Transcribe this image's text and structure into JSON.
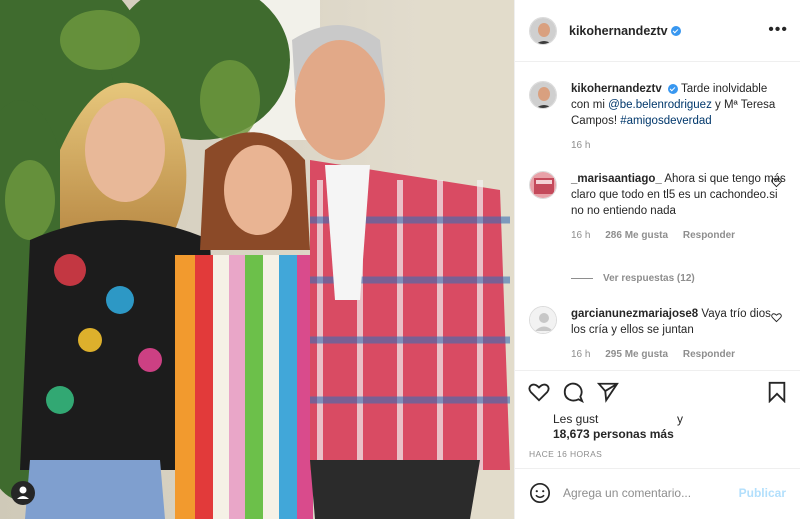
{
  "post": {
    "username": "kikohernandeztv",
    "caption_text_1": "Tarde inolvidable con mi",
    "caption_mention": "@be.belenrodriguez",
    "caption_text_2": "y Mª Teresa Campos!",
    "caption_hashtag": "#amigosdeverdad",
    "caption_time": "16 h",
    "more_label": "•••"
  },
  "comments": [
    {
      "username": "_marisaantiago_",
      "text": "Ahora si que tengo más claro que todo en tl5 es un cachondeo.si no no entiendo nada",
      "time": "16 h",
      "likes": "286 Me gusta",
      "reply": "Responder",
      "view_replies": "Ver respuestas (12)"
    },
    {
      "username": "garcianunezmariajose8",
      "text": "Vaya trío dios los cría y ellos se juntan",
      "time": "16 h",
      "likes": "295 Me gusta",
      "reply": "Responder"
    }
  ],
  "likes": {
    "line1": "Les gust",
    "line1_suffix": "y",
    "line2": "18,673 personas más"
  },
  "timestamp": "HACE 16 HORAS",
  "comment_input": {
    "placeholder": "Agrega un comentario...",
    "publish": "Publicar"
  },
  "icons": {
    "like": "heart-icon",
    "comment": "comment-icon",
    "share": "share-icon",
    "save": "bookmark-icon",
    "emoji": "emoji-icon",
    "user_tag": "user-tag-icon"
  },
  "colors": {
    "verified": "#3897f0",
    "link": "#00376b",
    "muted": "#8e8e8e",
    "publish_disabled": "#b2dffc"
  }
}
